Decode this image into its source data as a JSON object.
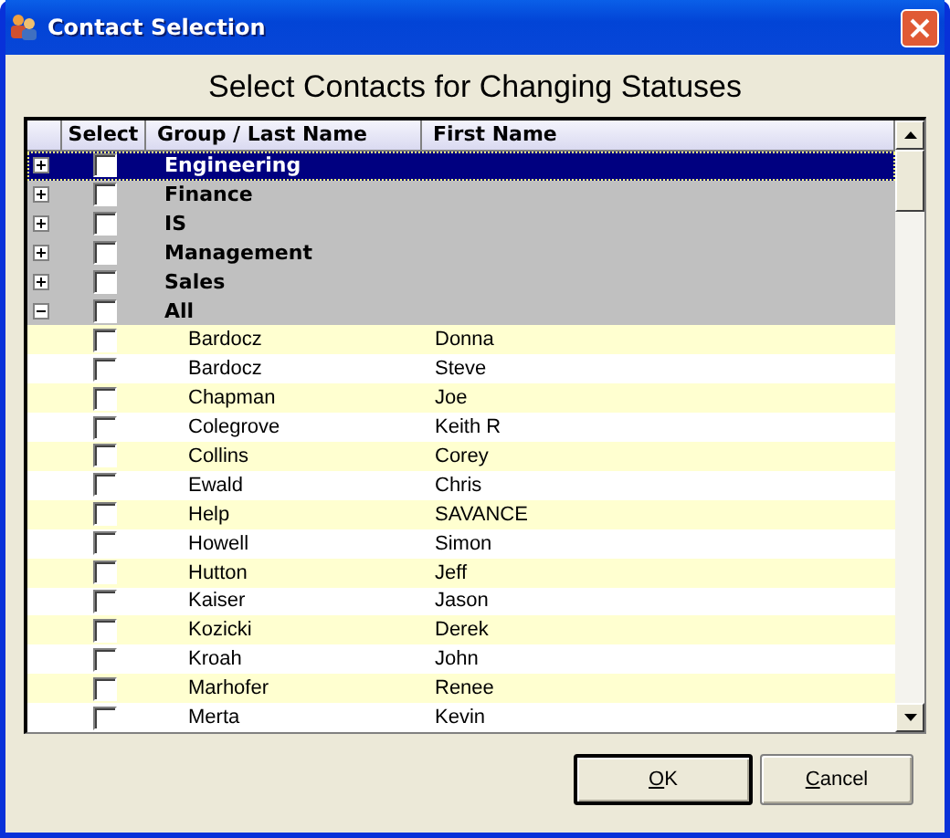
{
  "window": {
    "title": "Contact Selection"
  },
  "heading": "Select Contacts for Changing Statuses",
  "table": {
    "columns": [
      "Select",
      "Group / Last Name",
      "First Name"
    ],
    "groups": [
      {
        "name": "Engineering",
        "expanded": false,
        "selected": true,
        "checked": false
      },
      {
        "name": "Finance",
        "expanded": false,
        "selected": false,
        "checked": false
      },
      {
        "name": "IS",
        "expanded": false,
        "selected": false,
        "checked": false
      },
      {
        "name": "Management",
        "expanded": false,
        "selected": false,
        "checked": false
      },
      {
        "name": "Sales",
        "expanded": false,
        "selected": false,
        "checked": false
      },
      {
        "name": "All",
        "expanded": true,
        "selected": false,
        "checked": false,
        "children": [
          {
            "last": "Bardocz",
            "first": "Donna",
            "checked": false
          },
          {
            "last": "Bardocz",
            "first": "Steve",
            "checked": false
          },
          {
            "last": "Chapman",
            "first": "Joe",
            "checked": false
          },
          {
            "last": "Colegrove",
            "first": "Keith R",
            "checked": false
          },
          {
            "last": "Collins",
            "first": "Corey",
            "checked": false
          },
          {
            "last": "Ewald",
            "first": "Chris",
            "checked": false
          },
          {
            "last": "Help",
            "first": "SAVANCE",
            "checked": false
          },
          {
            "last": "Howell",
            "first": "Simon",
            "checked": false
          },
          {
            "last": "Hutton",
            "first": "Jeff",
            "checked": false
          },
          {
            "last": "Kaiser",
            "first": "Jason",
            "checked": false
          },
          {
            "last": "Kozicki",
            "first": "Derek",
            "checked": false
          },
          {
            "last": "Kroah",
            "first": "John",
            "checked": false
          },
          {
            "last": "Marhofer",
            "first": "Renee",
            "checked": false
          },
          {
            "last": "Merta",
            "first": "Kevin",
            "checked": false
          }
        ]
      }
    ]
  },
  "buttons": [
    {
      "label": "OK",
      "default": true
    },
    {
      "label": "Cancel",
      "default": false
    }
  ]
}
